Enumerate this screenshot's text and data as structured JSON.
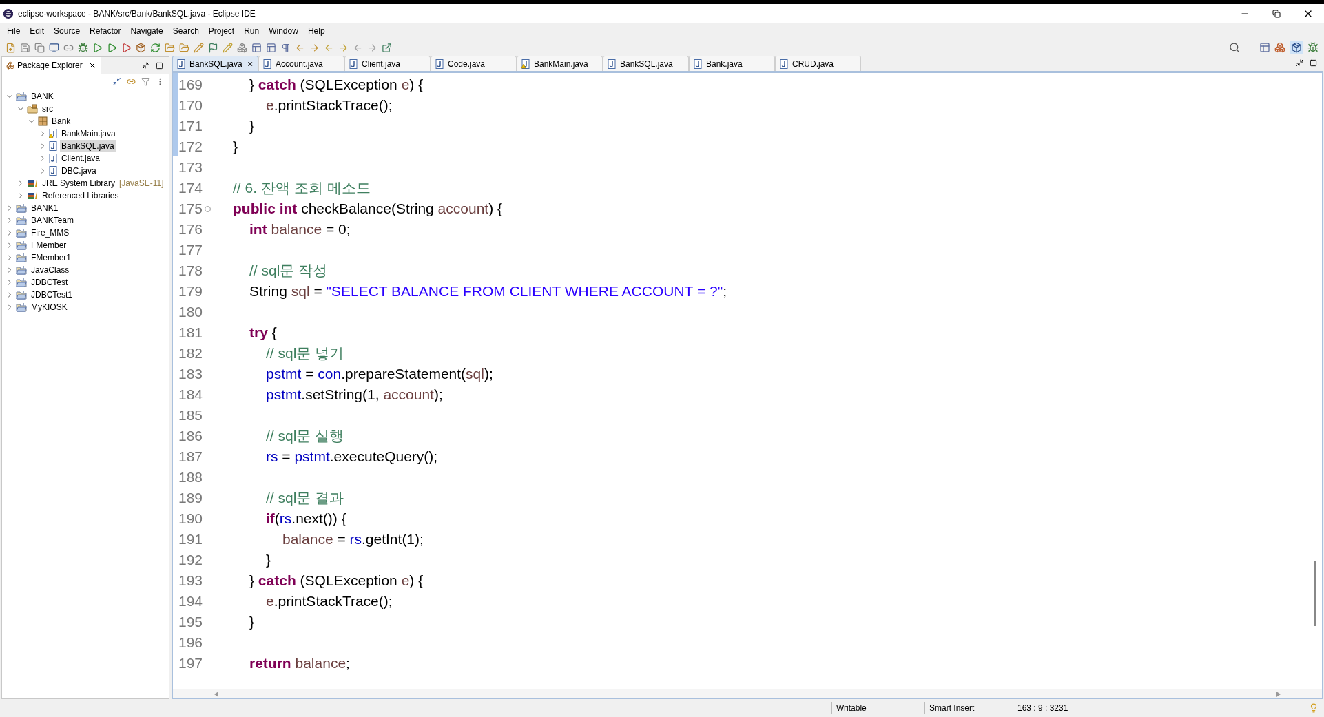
{
  "window": {
    "title": "eclipse-workspace - BANK/src/Bank/BankSQL.java - Eclipse IDE"
  },
  "menu": [
    "File",
    "Edit",
    "Source",
    "Refactor",
    "Navigate",
    "Search",
    "Project",
    "Run",
    "Window",
    "Help"
  ],
  "explorer": {
    "title": "Package Explorer",
    "tree": [
      {
        "label": "BANK",
        "kind": "project",
        "expanded": true,
        "selected": false,
        "children": [
          {
            "label": "src",
            "kind": "source",
            "expanded": true,
            "selected": false,
            "children": [
              {
                "label": "Bank",
                "kind": "package",
                "expanded": true,
                "selected": false,
                "children": [
                  {
                    "label": "BankMain.java",
                    "kind": "java",
                    "warning": true,
                    "expanded": false,
                    "selected": false
                  },
                  {
                    "label": "BankSQL.java",
                    "kind": "java",
                    "warning": false,
                    "expanded": false,
                    "selected": true
                  },
                  {
                    "label": "Client.java",
                    "kind": "java",
                    "warning": false,
                    "expanded": false,
                    "selected": false
                  },
                  {
                    "label": "DBC.java",
                    "kind": "java",
                    "warning": false,
                    "expanded": false,
                    "selected": false
                  }
                ]
              }
            ]
          },
          {
            "label": "JRE System Library",
            "decoration": "[JavaSE-11]",
            "kind": "library",
            "expanded": false,
            "selected": false
          },
          {
            "label": "Referenced Libraries",
            "kind": "library",
            "expanded": false,
            "selected": false
          }
        ]
      },
      {
        "label": "BANK1",
        "kind": "project",
        "expanded": false,
        "selected": false
      },
      {
        "label": "BANKTeam",
        "kind": "project",
        "expanded": false,
        "selected": false
      },
      {
        "label": "Fire_MMS",
        "kind": "project",
        "expanded": false,
        "selected": false
      },
      {
        "label": "FMember",
        "kind": "project",
        "expanded": false,
        "selected": false
      },
      {
        "label": "FMember1",
        "kind": "project",
        "expanded": false,
        "selected": false
      },
      {
        "label": "JavaClass",
        "kind": "project",
        "expanded": false,
        "selected": false
      },
      {
        "label": "JDBCTest",
        "kind": "project",
        "expanded": false,
        "selected": false
      },
      {
        "label": "JDBCTest1",
        "kind": "project",
        "expanded": false,
        "selected": false
      },
      {
        "label": "MyKIOSK",
        "kind": "project",
        "expanded": false,
        "selected": false
      }
    ]
  },
  "tabs": [
    {
      "label": "BankSQL.java",
      "selected": true,
      "warning": false
    },
    {
      "label": "Account.java",
      "selected": false,
      "warning": false
    },
    {
      "label": "Client.java",
      "selected": false,
      "warning": false
    },
    {
      "label": "Code.java",
      "selected": false,
      "warning": false
    },
    {
      "label": "BankMain.java",
      "selected": false,
      "warning": true
    },
    {
      "label": "BankSQL.java",
      "selected": false,
      "warning": false
    },
    {
      "label": "Bank.java",
      "selected": false,
      "warning": false
    },
    {
      "label": "CRUD.java",
      "selected": false,
      "warning": false
    }
  ],
  "code": [
    {
      "children": [
        {
          "children": [
            {
              "number": "169",
              "tokens": [
                {
                  "text": "} ",
                  "kind": "plain"
                },
                {
                  "text": "catch",
                  "kind": "keyword"
                },
                {
                  "text": " (SQLException ",
                  "kind": "plain"
                },
                {
                  "text": "e",
                  "kind": "local"
                },
                {
                  "text": ") {",
                  "kind": "plain"
                }
              ],
              "children": [
                {
                  "number": "170",
                  "tokens": [
                    {
                      "text": "e",
                      "kind": "local"
                    },
                    {
                      "text": ".printStackTrace();",
                      "kind": "plain"
                    }
                  ]
                }
              ]
            },
            {
              "number": "171",
              "tokens": [
                {
                  "text": "}",
                  "kind": "plain"
                }
              ]
            }
          ]
        },
        {
          "number": "172",
          "tokens": [
            {
              "text": "}",
              "kind": "plain"
            }
          ]
        },
        {
          "number": "173"
        },
        {
          "number": "174",
          "tokens": [
            {
              "text": "// 6. 잔액 조회 메소드",
              "kind": "comment"
            }
          ]
        },
        {
          "number": "175",
          "fold": true,
          "tokens": [
            {
              "text": "public int",
              "kind": "keyword"
            },
            {
              "text": " checkBalance(String ",
              "kind": "plain"
            },
            {
              "text": "account",
              "kind": "local"
            },
            {
              "text": ") {",
              "kind": "plain"
            }
          ],
          "children": [
            {
              "number": "176",
              "tokens": [
                {
                  "text": "int ",
                  "kind": "keyword"
                },
                {
                  "text": "balance",
                  "kind": "local"
                },
                {
                  "text": " = 0;",
                  "kind": "plain"
                }
              ]
            },
            {
              "number": "177"
            },
            {
              "number": "178",
              "tokens": [
                {
                  "text": "// sql문 작성",
                  "kind": "comment"
                }
              ]
            },
            {
              "number": "179",
              "tokens": [
                {
                  "text": "String ",
                  "kind": "plain"
                },
                {
                  "text": "sql",
                  "kind": "local"
                },
                {
                  "text": " = ",
                  "kind": "plain"
                },
                {
                  "text": "\"SELECT BALANCE FROM CLIENT WHERE ACCOUNT = ?\"",
                  "kind": "string"
                },
                {
                  "text": ";",
                  "kind": "plain"
                }
              ]
            },
            {
              "number": "180"
            },
            {
              "number": "181",
              "tokens": [
                {
                  "text": "try",
                  "kind": "keyword"
                },
                {
                  "text": " {",
                  "kind": "plain"
                }
              ],
              "children": [
                {
                  "number": "182",
                  "tokens": [
                    {
                      "text": "// sql문 넣기",
                      "kind": "comment"
                    }
                  ]
                },
                {
                  "number": "183",
                  "tokens": [
                    {
                      "text": "pstmt",
                      "kind": "field"
                    },
                    {
                      "text": " = ",
                      "kind": "plain"
                    },
                    {
                      "text": "con",
                      "kind": "field"
                    },
                    {
                      "text": ".prepareStatement(",
                      "kind": "plain"
                    },
                    {
                      "text": "sql",
                      "kind": "local"
                    },
                    {
                      "text": ");",
                      "kind": "plain"
                    }
                  ]
                },
                {
                  "number": "184",
                  "tokens": [
                    {
                      "text": "pstmt",
                      "kind": "field"
                    },
                    {
                      "text": ".setString(1, ",
                      "kind": "plain"
                    },
                    {
                      "text": "account",
                      "kind": "local"
                    },
                    {
                      "text": ");",
                      "kind": "plain"
                    }
                  ]
                },
                {
                  "number": "185"
                },
                {
                  "number": "186",
                  "tokens": [
                    {
                      "text": "// sql문 실행",
                      "kind": "comment"
                    }
                  ]
                },
                {
                  "number": "187",
                  "tokens": [
                    {
                      "text": "rs",
                      "kind": "field"
                    },
                    {
                      "text": " = ",
                      "kind": "plain"
                    },
                    {
                      "text": "pstmt",
                      "kind": "field"
                    },
                    {
                      "text": ".executeQuery();",
                      "kind": "plain"
                    }
                  ]
                },
                {
                  "number": "188"
                },
                {
                  "number": "189",
                  "tokens": [
                    {
                      "text": "// sql문 결과",
                      "kind": "comment"
                    }
                  ]
                },
                {
                  "number": "190",
                  "tokens": [
                    {
                      "text": "if",
                      "kind": "keyword"
                    },
                    {
                      "text": "(",
                      "kind": "plain"
                    },
                    {
                      "text": "rs",
                      "kind": "field"
                    },
                    {
                      "text": ".next()) {",
                      "kind": "plain"
                    }
                  ],
                  "children": [
                    {
                      "number": "191",
                      "tokens": [
                        {
                          "text": "balance",
                          "kind": "local"
                        },
                        {
                          "text": " = ",
                          "kind": "plain"
                        },
                        {
                          "text": "rs",
                          "kind": "field"
                        },
                        {
                          "text": ".getInt(1);",
                          "kind": "plain"
                        }
                      ]
                    }
                  ]
                },
                {
                  "number": "192",
                  "tokens": [
                    {
                      "text": "}",
                      "kind": "plain"
                    }
                  ]
                }
              ]
            },
            {
              "number": "193",
              "tokens": [
                {
                  "text": "} ",
                  "kind": "plain"
                },
                {
                  "text": "catch",
                  "kind": "keyword"
                },
                {
                  "text": " (SQLException ",
                  "kind": "plain"
                },
                {
                  "text": "e",
                  "kind": "local"
                },
                {
                  "text": ") {",
                  "kind": "plain"
                }
              ],
              "children": [
                {
                  "number": "194",
                  "tokens": [
                    {
                      "text": "e",
                      "kind": "local"
                    },
                    {
                      "text": ".printStackTrace();",
                      "kind": "plain"
                    }
                  ]
                }
              ]
            },
            {
              "number": "195",
              "tokens": [
                {
                  "text": "}",
                  "kind": "plain"
                }
              ]
            },
            {
              "number": "196"
            },
            {
              "number": "197",
              "tokens": [
                {
                  "text": "return ",
                  "kind": "keyword"
                },
                {
                  "text": "balance",
                  "kind": "local"
                },
                {
                  "text": ";",
                  "kind": "plain"
                }
              ]
            }
          ]
        }
      ]
    }
  ],
  "status_bar": [
    "Writable",
    "Smart Insert",
    "163 : 9 : 3231"
  ]
}
